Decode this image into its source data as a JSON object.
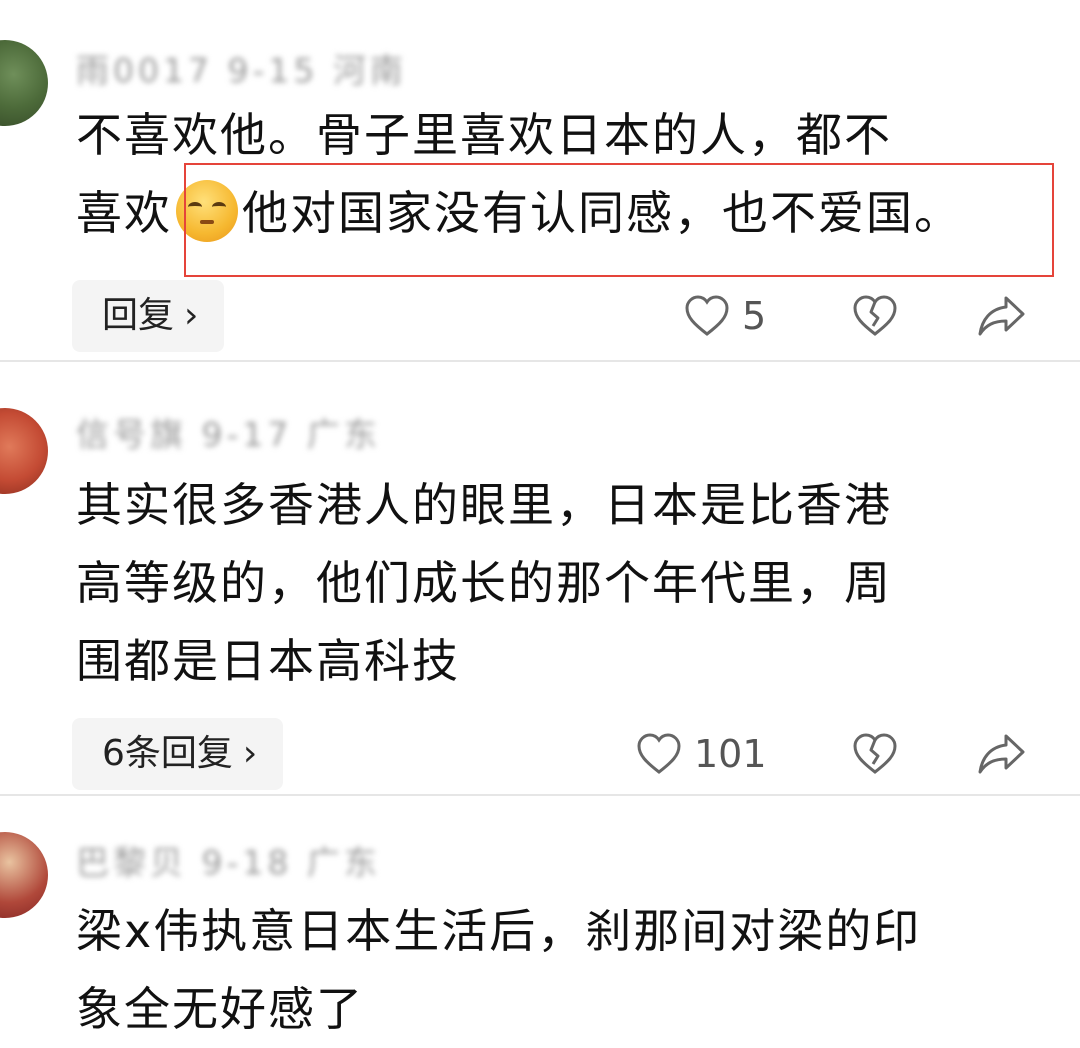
{
  "comments": [
    {
      "username": "雨0017",
      "time": "9-15",
      "location": "河南",
      "text_lines": [
        "不喜欢他。骨子里喜欢日本的人，都不",
        "喜欢",
        "他对国家没有认同感，也不爱国。"
      ],
      "emoji": "unamused-face-icon",
      "reply_label": "回复",
      "likes": "5"
    },
    {
      "username": "信号旗",
      "time": "9-17",
      "location": "广东",
      "text_lines": [
        "其实很多香港人的眼里，日本是比香港",
        "高等级的，他们成长的那个年代里，周",
        "围都是日本高科技"
      ],
      "reply_label": "6条回复",
      "likes": "101"
    },
    {
      "username": "巴黎贝",
      "time": "9-18",
      "location": "广东",
      "text_lines": [
        "梁x伟执意日本生活后，刹那间对梁的印",
        "象全无好感了"
      ]
    }
  ],
  "highlight_color": "#e5443a",
  "icons": {
    "like": "heart-outline-icon",
    "dislike": "broken-heart-icon",
    "share": "share-arrow-icon",
    "chevron": "chevron-right-icon"
  },
  "chevron_glyph": "›"
}
